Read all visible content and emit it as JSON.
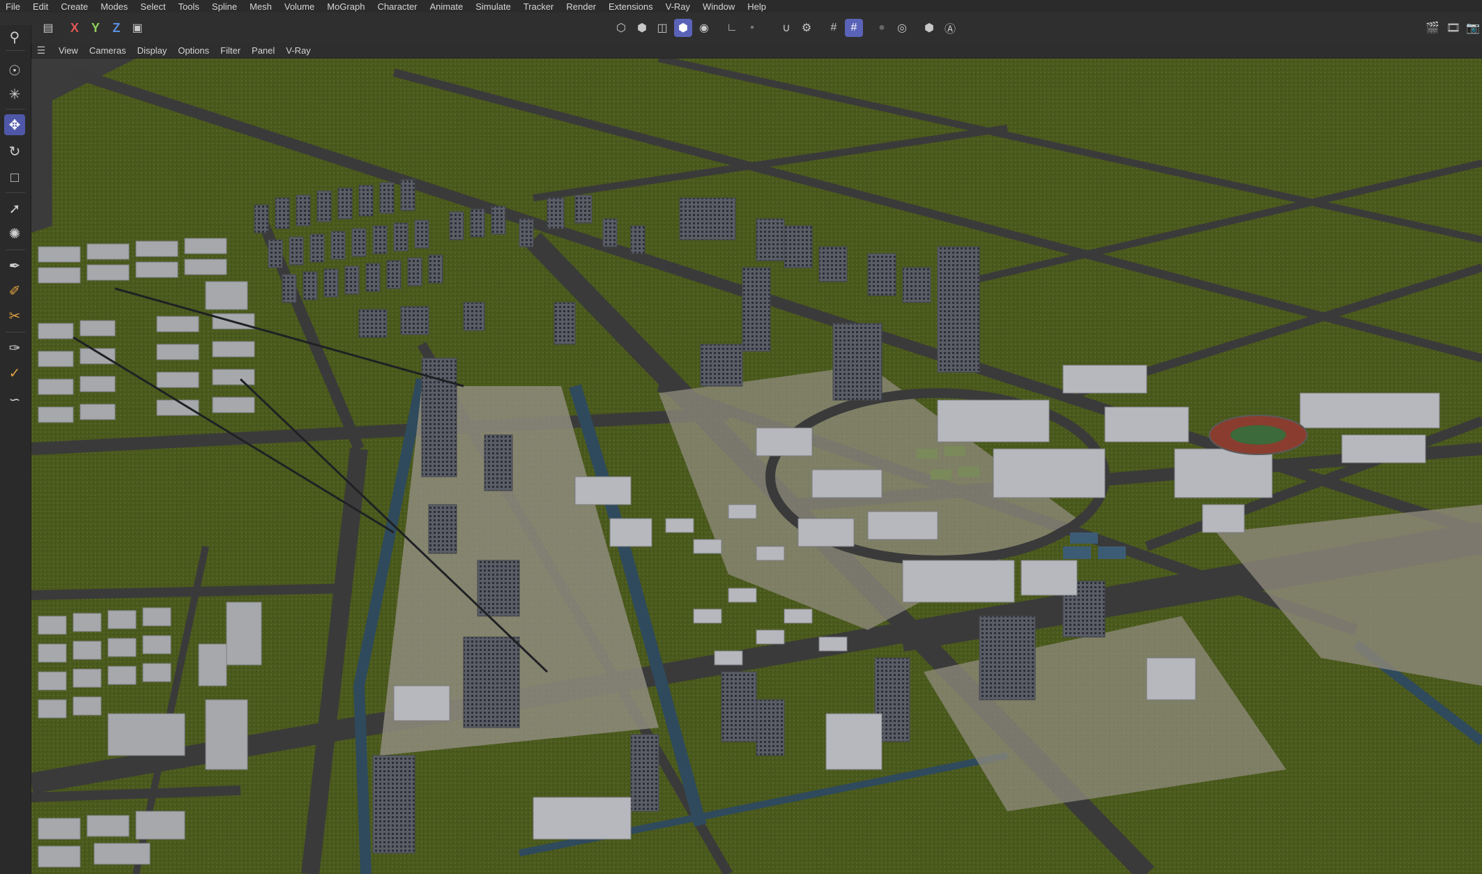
{
  "menu": [
    "File",
    "Edit",
    "Create",
    "Modes",
    "Select",
    "Tools",
    "Spline",
    "Mesh",
    "Volume",
    "MoGraph",
    "Character",
    "Animate",
    "Simulate",
    "Tracker",
    "Render",
    "Extensions",
    "V-Ray",
    "Window",
    "Help"
  ],
  "toolbar": {
    "axis_x": "X",
    "axis_y": "Y",
    "axis_z": "Z"
  },
  "viewport_menu": [
    "View",
    "Cameras",
    "Display",
    "Options",
    "Filter",
    "Panel",
    "V-Ray"
  ],
  "colors": {
    "ui_bg": "#262626",
    "accent_active": "#5a63b8",
    "grass": "#4b5a1e",
    "road": "#3a3a3a",
    "water": "#2f4a5c",
    "building": "#9a9ca2"
  },
  "icons": {
    "left_tools": [
      "search-icon",
      "live-selection-icon",
      "transform-icon",
      "move-icon",
      "rotate-icon",
      "scale-icon",
      "move-axis-icon",
      "placement-icon",
      "spline-pen-icon",
      "spline-sketch-icon",
      "knife-icon",
      "brush-icon",
      "paint-icon",
      "smooth-icon"
    ]
  }
}
